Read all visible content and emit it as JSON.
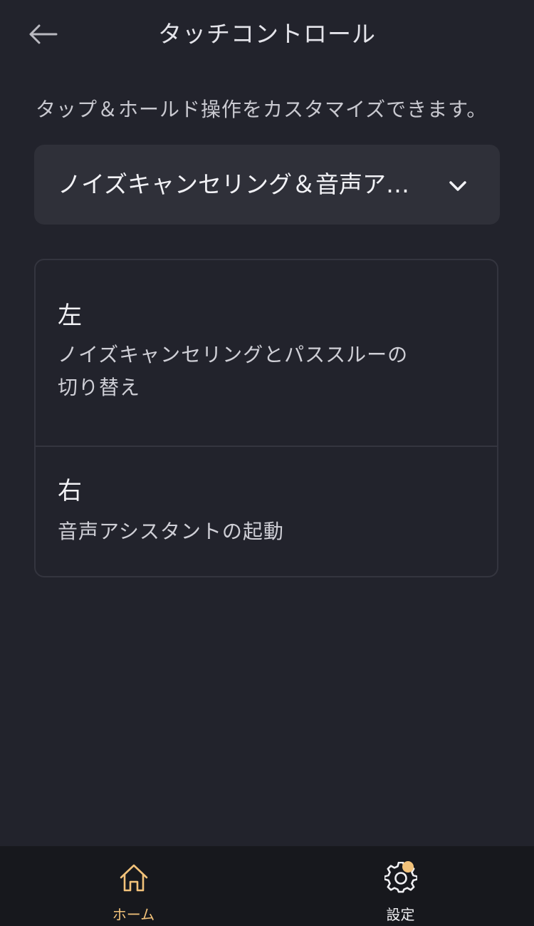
{
  "header": {
    "title": "タッチコントロール",
    "back_icon": "arrow-left-icon"
  },
  "description": "タップ＆ホールド操作をカスタマイズできます。",
  "mode_select": {
    "selected": "ノイズキャンセリング＆音声ア…",
    "chevron_icon": "chevron-down-icon"
  },
  "controls": [
    {
      "side": "左",
      "action": "ノイズキャンセリングとパススルーの切り替え"
    },
    {
      "side": "右",
      "action": "音声アシスタントの起動"
    }
  ],
  "tabbar": {
    "home": {
      "label": "ホーム",
      "icon": "home-icon",
      "active": true
    },
    "settings": {
      "label": "設定",
      "icon": "gear-icon",
      "badge": true
    }
  },
  "colors": {
    "background": "#22232c",
    "card": "#2f3039",
    "accent": "#f2c27a",
    "tabbar": "#17181d"
  }
}
